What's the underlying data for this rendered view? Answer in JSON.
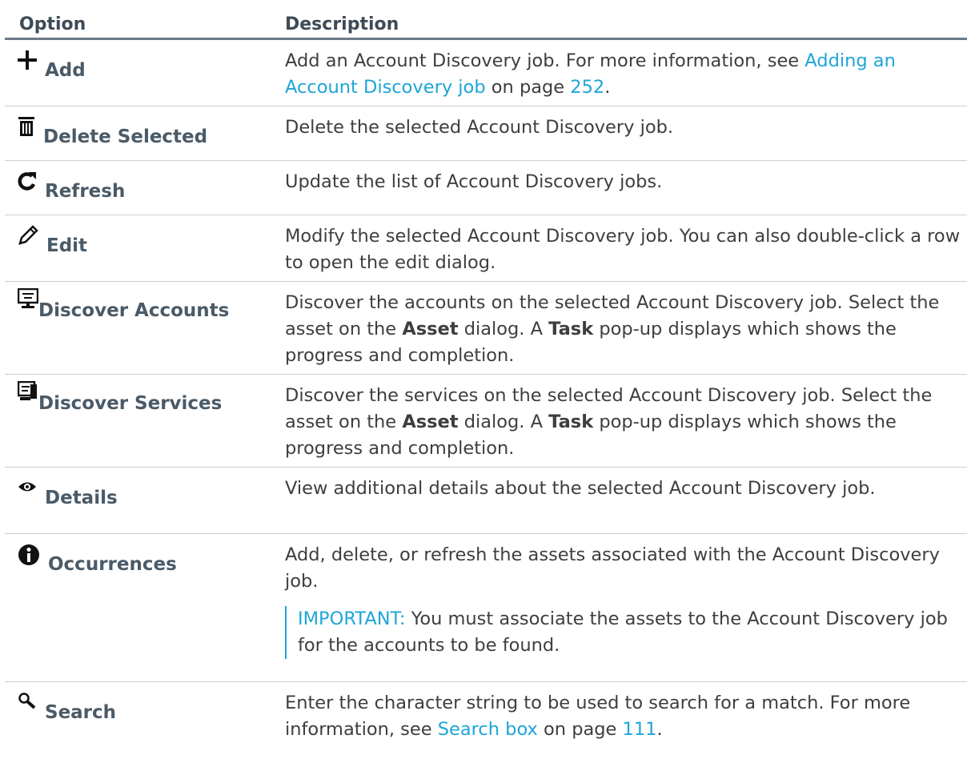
{
  "header": {
    "option": "Option",
    "description": "Description"
  },
  "rows": [
    {
      "icon": "plus-icon",
      "label": "Add",
      "desc_pre": "Add an Account Discovery job. For more information, see",
      "link": "Adding an Account Discovery job",
      "mid": "on page",
      "page": "252",
      "post": "."
    },
    {
      "icon": "trash-icon",
      "label": "Delete Selected",
      "desc": "Delete the selected Account Discovery job."
    },
    {
      "icon": "refresh-icon",
      "label": "Refresh",
      "desc": "Update the list of Account Discovery jobs."
    },
    {
      "icon": "pencil-icon",
      "label": "Edit",
      "desc": "Modify the selected Account Discovery job. You can also double-click a row to open the edit dialog."
    },
    {
      "icon": "monitor-icon",
      "label": "Discover Accounts",
      "desc_a": "Discover the accounts on the selected Account Discovery job. Select the asset on the",
      "bold1": "Asset",
      "desc_b": "dialog. A",
      "bold2": "Task",
      "desc_c": "pop-up displays which shows the progress and completion."
    },
    {
      "icon": "monitor-services-icon",
      "label": "Discover Services",
      "desc_a": "Discover the services on the selected Account Discovery job. Select the asset on the",
      "bold1": "Asset",
      "desc_b": "dialog. A",
      "bold2": "Task",
      "desc_c": "pop-up displays which shows the progress and completion."
    },
    {
      "icon": "eye-icon",
      "label": "Details",
      "desc": "View additional details about the selected Account Discovery job."
    },
    {
      "icon": "info-icon",
      "label": "Occurrences",
      "desc": "Add, delete, or refresh the assets associated with the Account Discovery job.",
      "important_label": "IMPORTANT:",
      "important_text": "You must associate the assets to the Account Discovery job for the accounts to be found."
    },
    {
      "icon": "search-icon",
      "label": "Search",
      "desc_pre": "Enter the character string to be used to search for a match. For more information, see",
      "link": "Search box",
      "mid": "on page",
      "page": "111",
      "post": "."
    }
  ]
}
